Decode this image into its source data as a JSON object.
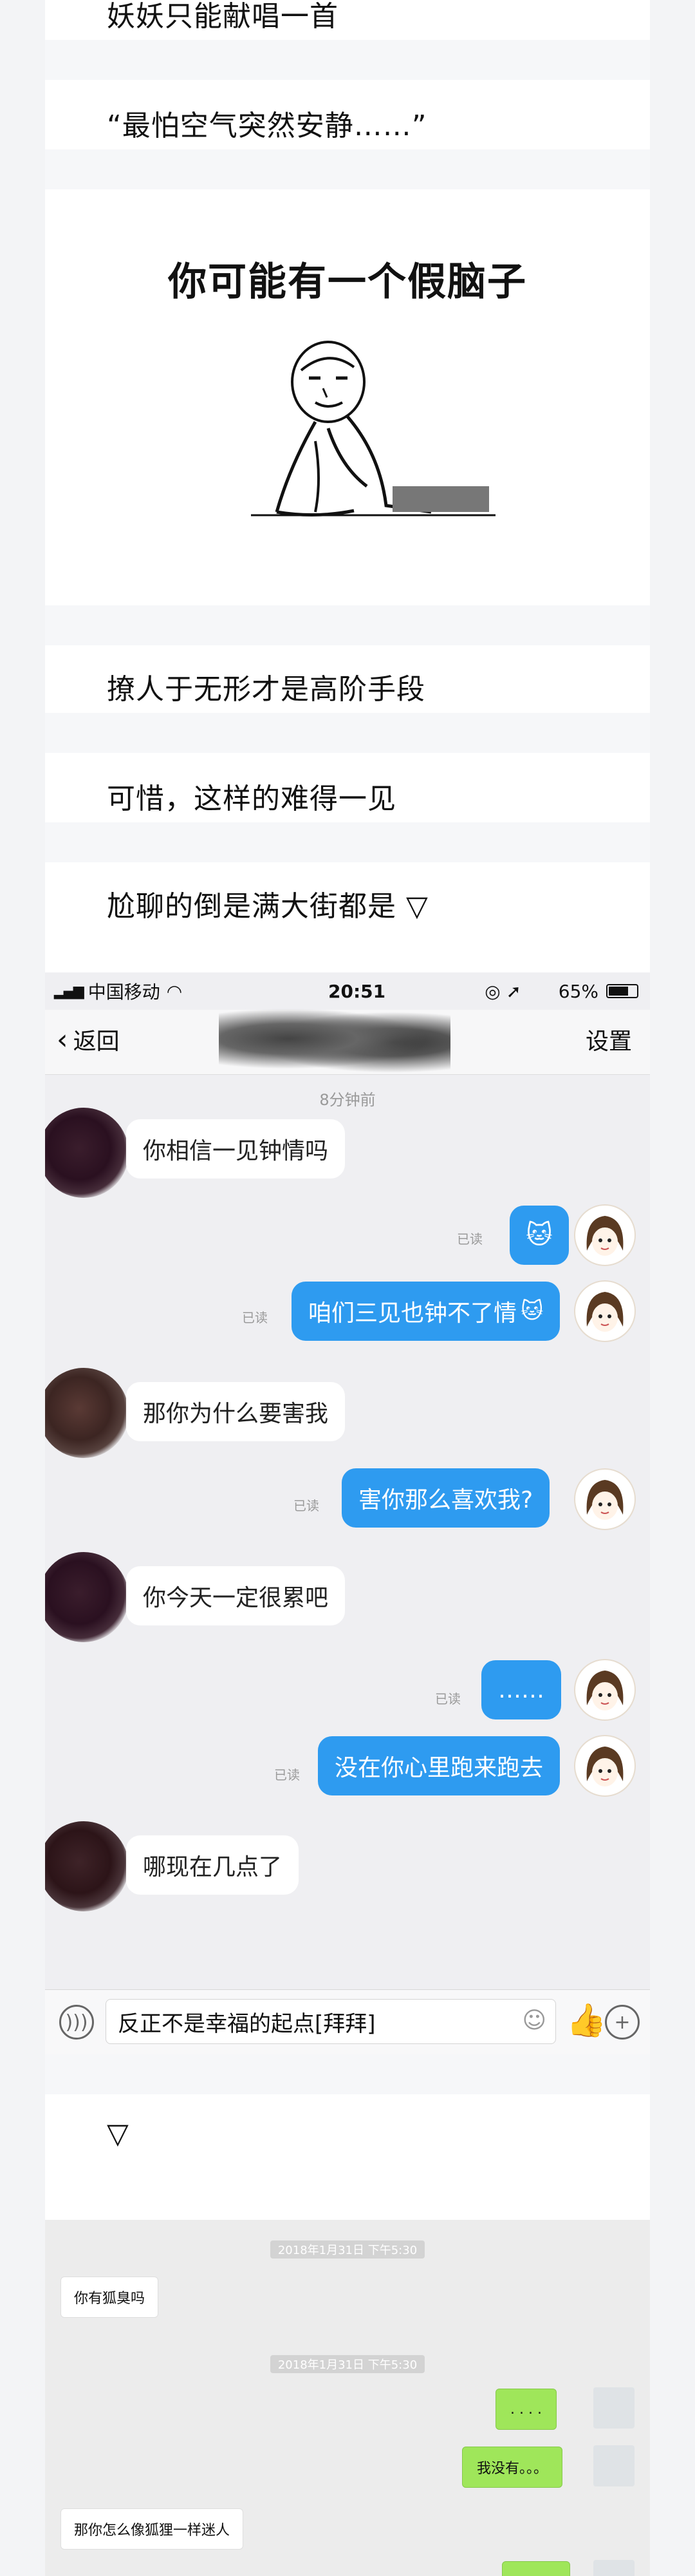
{
  "article": {
    "line_top": "妖妖只能献唱一首",
    "line_quote": "“最怕空气突然安静……”",
    "meme_caption": "你可能有一个假脑子",
    "line_flirt": "撩人于无形才是高阶手段",
    "line_rare": "可惜，这样的难得一见",
    "line_awkward": "尬聊的倒是满大街都是 ▽",
    "triangle": "▽"
  },
  "chat1": {
    "carrier": "中国移动",
    "time": "20:51",
    "battery": "65%",
    "back_label": "返回",
    "settings_label": "设置",
    "stamp": "8分钟前",
    "read_label": "已读",
    "messages": [
      {
        "side": "left",
        "text": "你相信一见钟情吗"
      },
      {
        "side": "right",
        "text": "",
        "emoji": "cat-face-sticker"
      },
      {
        "side": "right",
        "text": "咱们三见也钟不了情"
      },
      {
        "side": "left",
        "text": "那你为什么要害我"
      },
      {
        "side": "right",
        "text": "害你那么喜欢我?"
      },
      {
        "side": "left",
        "text": "你今天一定很累吧"
      },
      {
        "side": "right",
        "text": "……"
      },
      {
        "side": "right",
        "text": "没在你心里跑来跑去"
      },
      {
        "side": "left",
        "text": "哪现在几点了"
      }
    ],
    "input_value": "反正不是幸福的起点[拜拜]"
  },
  "chat2": {
    "stamp1": "2018年1月31日 下午5:30",
    "stamp2": "2018年1月31日 下午5:30",
    "messages": [
      {
        "side": "left",
        "text": "你有狐臭吗"
      },
      {
        "side": "right",
        "text": ". . . ."
      },
      {
        "side": "right",
        "text": "我没有。。。"
      },
      {
        "side": "left",
        "text": "那你怎么像狐狸一样迷人"
      }
    ]
  },
  "colors": {
    "bubble_blue": "#2e9bf0",
    "bubble_green": "#9fe65a"
  }
}
